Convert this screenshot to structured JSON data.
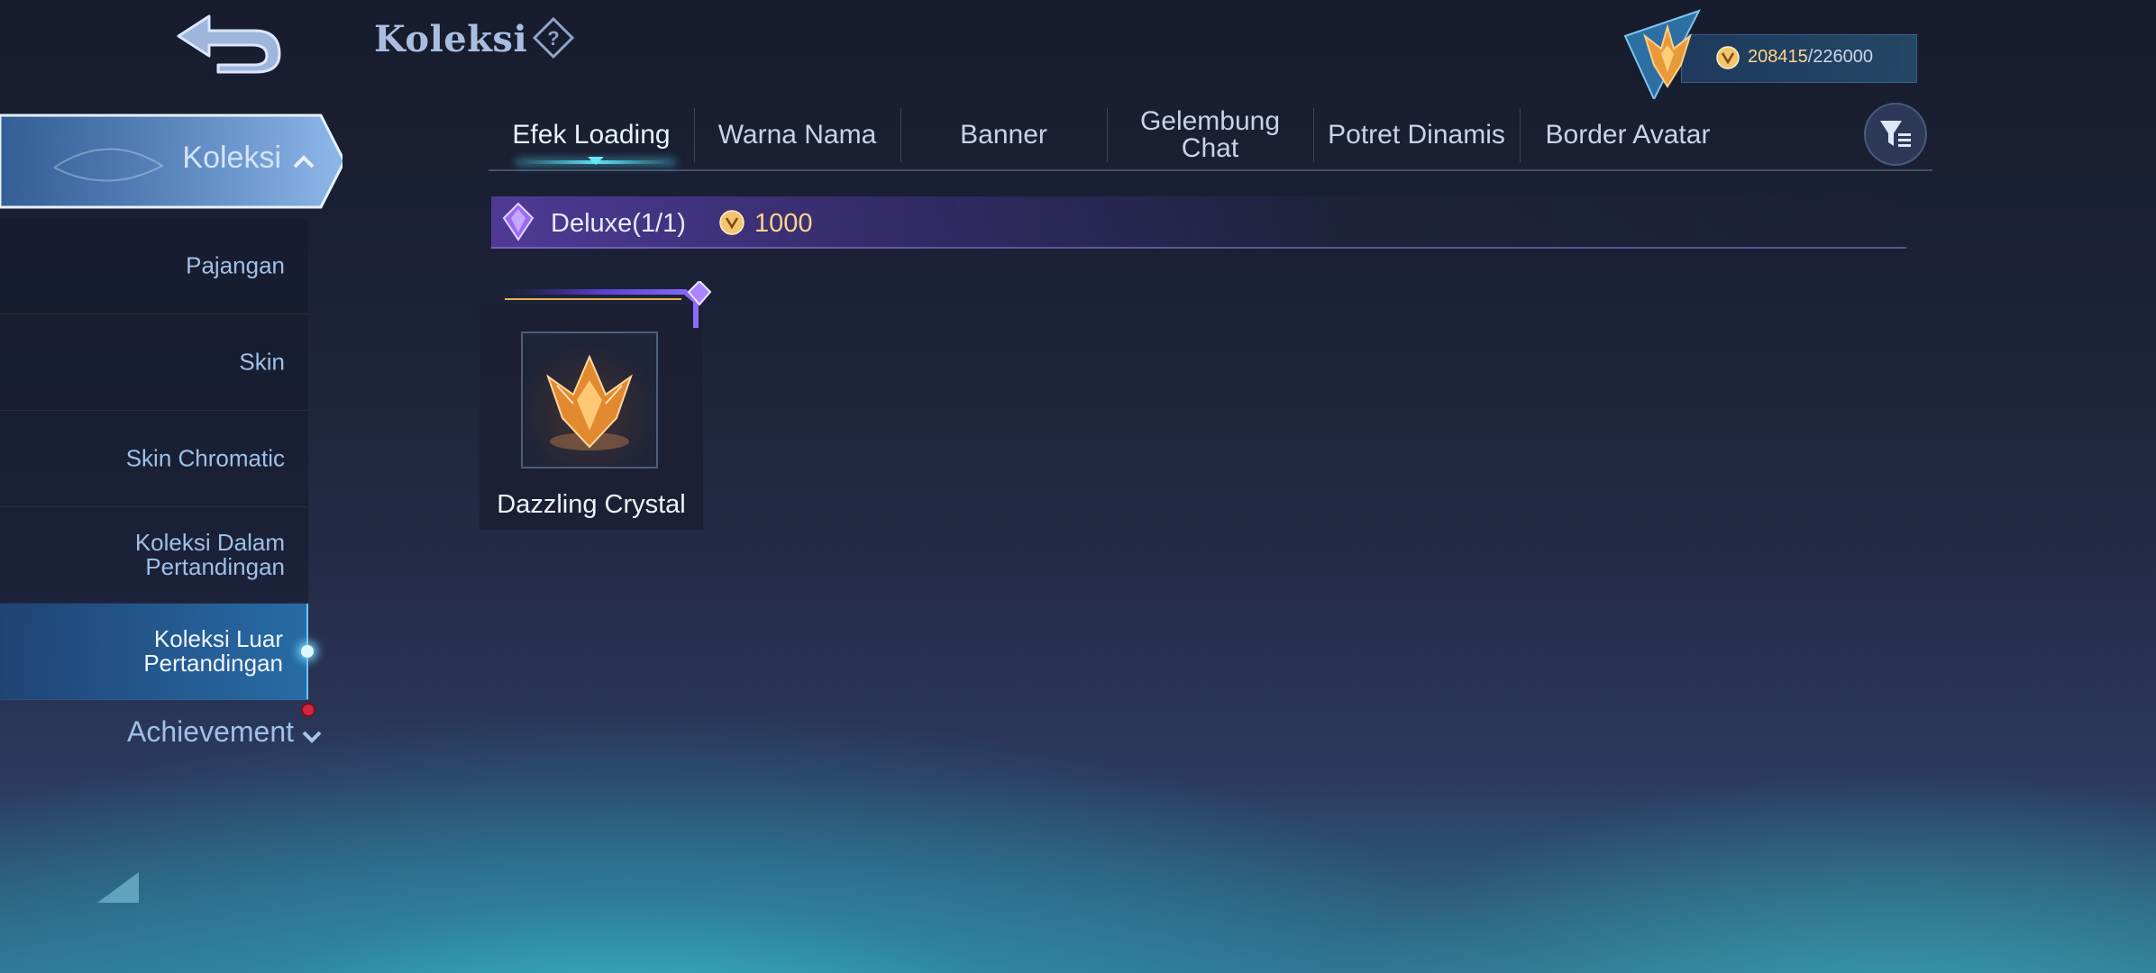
{
  "header": {
    "title": "Koleksi",
    "currency": {
      "current": "208415",
      "max": "/226000"
    }
  },
  "sidebar": {
    "active_section": "Koleksi",
    "items": [
      {
        "label": "Pajangan"
      },
      {
        "label": "Skin"
      },
      {
        "label": "Skin Chromatic"
      },
      {
        "label": "Koleksi Dalam\nPertandingan"
      },
      {
        "label": "Koleksi Luar\nPertandingan",
        "selected": true
      }
    ],
    "achievement": "Achievement"
  },
  "tabs": [
    {
      "label": "Efek Loading",
      "active": true
    },
    {
      "label": "Warna Nama"
    },
    {
      "label": "Banner"
    },
    {
      "label": "Gelembung\nChat"
    },
    {
      "label": "Potret Dinamis"
    },
    {
      "label": "Border Avatar"
    }
  ],
  "section": {
    "label": "Deluxe(1/1)",
    "price": "1000"
  },
  "items": [
    {
      "name": "Dazzling Crystal"
    }
  ],
  "colors": {
    "accent_cyan": "#5fe2f5",
    "deluxe_purple": "#7a50e6",
    "currency_gold": "#ffd38a",
    "notification_red": "#d2263d"
  }
}
